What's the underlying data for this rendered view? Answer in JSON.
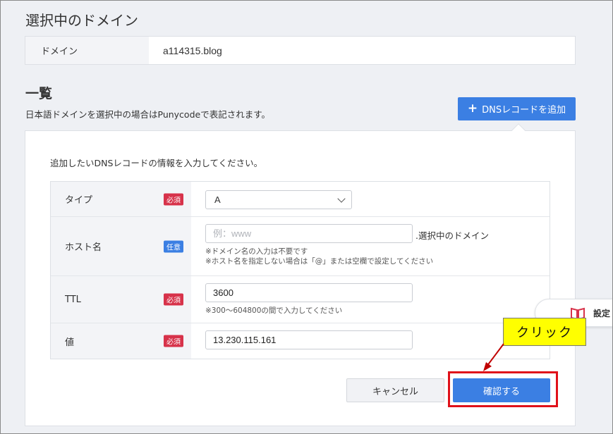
{
  "section": {
    "title": "選択中のドメイン"
  },
  "domain": {
    "label": "ドメイン",
    "value": "a114315.blog"
  },
  "list": {
    "title": "一覧",
    "note": "日本語ドメインを選択中の場合はPunycodeで表記されます。",
    "add_button_label": "DNSレコードを追加"
  },
  "form": {
    "intro": "追加したいDNSレコードの情報を入力してください。",
    "rows": [
      {
        "label": "タイプ",
        "badge": "必須",
        "value": "A"
      },
      {
        "label": "ホスト名",
        "badge": "任意",
        "value": "",
        "placeholder": "例：www",
        "suffix": ".選択中のドメイン",
        "hints": [
          "※ドメイン名の入力は不要です",
          "※ホスト名を指定しない場合は「@」または空欄で設定してください"
        ]
      },
      {
        "label": "TTL",
        "badge": "必須",
        "value": "3600",
        "hints": [
          "※300～604800の間で入力してください"
        ]
      },
      {
        "label": "値",
        "badge": "必須",
        "value": "13.230.115.161"
      }
    ],
    "cancel_label": "キャンセル",
    "confirm_label": "確認する"
  },
  "annotation": {
    "callout_text": "クリック",
    "highlight_color": "#e0111a",
    "callout_color": "#ffff00"
  },
  "side_tab": {
    "label": "設定",
    "icon": "book-icon"
  },
  "colors": {
    "accent": "#3b7fe3",
    "required_badge": "#d7324a",
    "optional_badge": "#3b7fe3"
  }
}
